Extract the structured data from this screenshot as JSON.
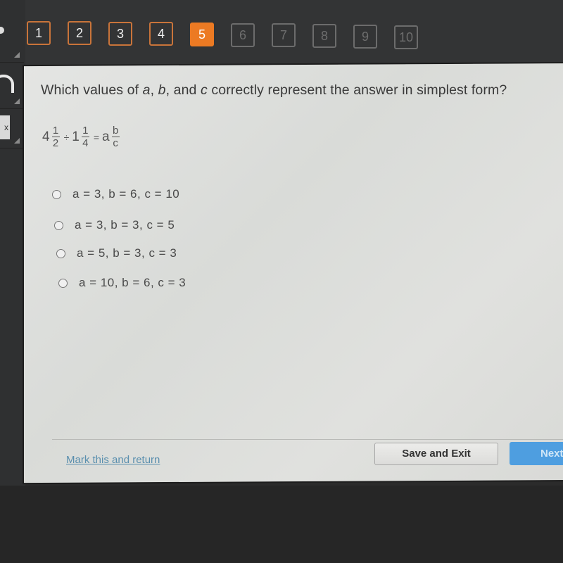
{
  "question_nav": {
    "items": [
      {
        "label": "1",
        "state": "answered"
      },
      {
        "label": "2",
        "state": "answered"
      },
      {
        "label": "3",
        "state": "answered"
      },
      {
        "label": "4",
        "state": "answered"
      },
      {
        "label": "5",
        "state": "current"
      },
      {
        "label": "6",
        "state": "locked"
      },
      {
        "label": "7",
        "state": "locked"
      },
      {
        "label": "8",
        "state": "locked"
      },
      {
        "label": "9",
        "state": "locked"
      },
      {
        "label": "10",
        "state": "locked"
      }
    ],
    "colors": {
      "current": "#ec7a23",
      "answered_border": "#c9743a",
      "locked_border": "#6c6c6c"
    }
  },
  "sidebar": {
    "tools": [
      {
        "icon": "bullet-icon"
      },
      {
        "icon": "headphones-icon"
      },
      {
        "icon": "calculator-icon",
        "glyph": "x"
      }
    ]
  },
  "question": {
    "prefix": "Which values of ",
    "var_a": "a",
    "sep1": ", ",
    "var_b": "b",
    "sep2": ", and ",
    "var_c": "c",
    "suffix": " correctly represent the answer in simplest form?",
    "equation": {
      "whole1": "4",
      "num1": "1",
      "den1": "2",
      "op": "÷",
      "whole2": "1",
      "num2": "1",
      "den2": "4",
      "eq": "=",
      "whole3": "a",
      "num3": "b",
      "den3": "c"
    }
  },
  "options": [
    {
      "label": "a = 3, b = 6, c = 10",
      "selected": false
    },
    {
      "label": "a = 3, b = 3, c = 5",
      "selected": false
    },
    {
      "label": "a = 5, b = 3, c = 3",
      "selected": false
    },
    {
      "label": "a = 10, b = 6, c = 3",
      "selected": false
    }
  ],
  "footer": {
    "mark_link": "Mark this and return",
    "save_exit": "Save and Exit",
    "next": "Next"
  }
}
